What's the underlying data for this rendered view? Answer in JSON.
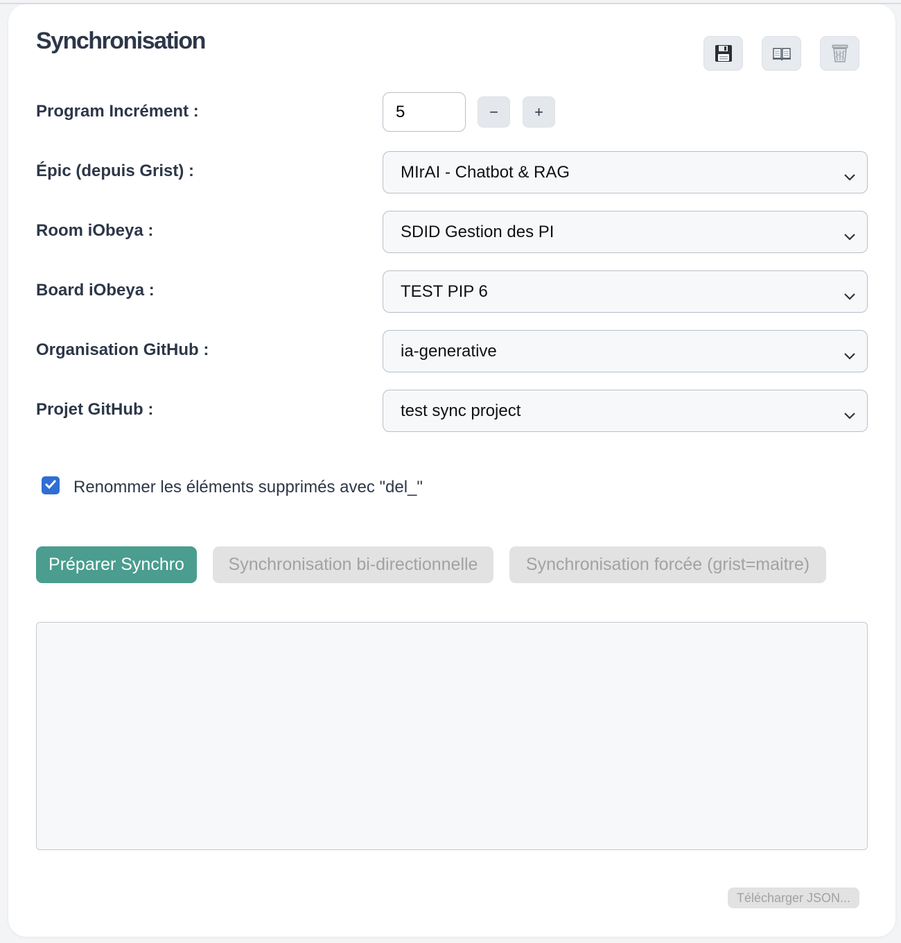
{
  "title": "Synchronisation",
  "toolbar": {
    "save_icon": "floppy-disk-icon",
    "docs_icon": "open-book-icon",
    "delete_icon": "trash-can-icon"
  },
  "form": {
    "program_increment": {
      "label": "Program Incrément :",
      "value": "5",
      "decrement": "−",
      "increment": "+"
    },
    "epic": {
      "label": "Épic (depuis Grist) :",
      "value": "MIrAI - Chatbot & RAG"
    },
    "room": {
      "label": "Room iObeya :",
      "value": "SDID Gestion des PI"
    },
    "board": {
      "label": "Board iObeya :",
      "value": "TEST PIP 6"
    },
    "org": {
      "label": "Organisation GitHub :",
      "value": "ia-generative"
    },
    "project": {
      "label": "Projet GitHub :",
      "value": "test sync project"
    }
  },
  "rename_option": {
    "label": "Renommer les éléments supprimés avec \"del_\"",
    "checked": true
  },
  "actions": {
    "prepare": "Préparer Synchro",
    "bidirectional": "Synchronisation bi-directionnelle",
    "forced": "Synchronisation forcée (grist=maitre)"
  },
  "output": {
    "value": ""
  },
  "download": "Télécharger JSON...",
  "colors": {
    "primary": "#4a9d8f",
    "checkbox": "#2f6ed3",
    "disabled_bg": "#e2e2e2",
    "disabled_text": "#a2a2a2"
  }
}
